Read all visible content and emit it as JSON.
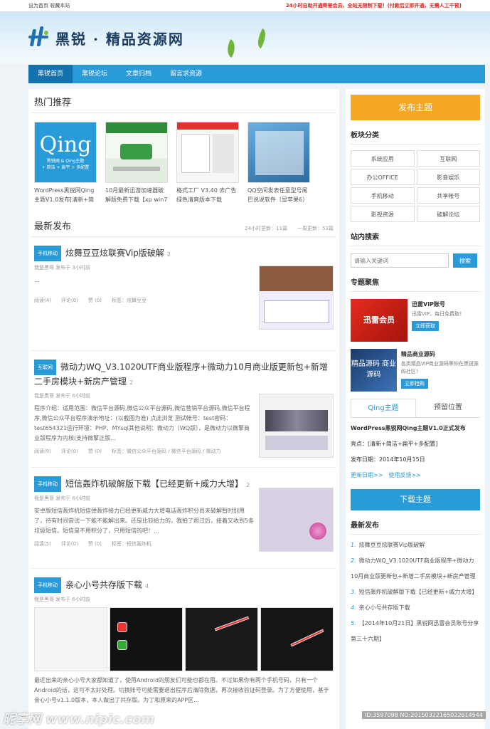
{
  "topbar": {
    "left": "设为首页 收藏本站",
    "notice": "24小时自助开通荣誉会员，全站无限制下载！(付款后立即开通，无需人工干预)"
  },
  "site": {
    "title": "黑锐 · 精品资源网"
  },
  "nav": [
    "黑锐首页",
    "黑锐论坛",
    "文章归档",
    "留言求资源"
  ],
  "hot": {
    "title": "热门推荐",
    "items": [
      {
        "caption": "WordPress黑锐网Qing主题V1.0发布[清新+简"
      },
      {
        "caption": "10月最新迅游加速器破解版免费下载【xp win7"
      },
      {
        "caption": "格式工厂 V3.40 去广告绿色清爽版本下载"
      },
      {
        "caption": "QQ空间发表任意型号尾巴说说软件（显苹果6）"
      }
    ]
  },
  "qing_thumb": {
    "big": "Qing",
    "sub1": "黑锐网 & Qing主题",
    "sub2": "+ 简洁 + 扁平 + 多配置"
  },
  "latest": {
    "title": "最新发布",
    "stats": "24小时更新：11篇　　一周更新：53篇"
  },
  "posts": [
    {
      "tag": "手机移动",
      "title": "炫舞豆豆炫联赛Vip版破解",
      "count": "2",
      "meta": "我是黑哥 发布于 3小时前",
      "excerpt": "...",
      "reads": "阅读(4)",
      "comments": "评论(0)",
      "likes": "赞 (0)",
      "tags": "标签：炫舞豆豆"
    },
    {
      "tag": "互联网",
      "title": "微动力WQ_V3.1020UTF商业版程序+微动力10月商业版更新包+新增二手房模块+新房产管理",
      "count": "2",
      "meta": "我是黑哥 发布于 6小时前",
      "excerpt": "程序介绍：适用范围：微信平台源码,微信公众平台源码,微信营销平台源码,微信平台程序,微信公众平台程序演示地址：(以截图为准) 点此浏览 测试帐号：test密码：test654321运行环境：PHP、MYsql其他说明：微动力（WQ版），是微动力以微擎商业版程序为内核(支持微擎正版...",
      "reads": "阅读(9)",
      "comments": "评论(0)",
      "likes": "赞 (0)",
      "tags": "标签：微信公众平台源码 / 微信平台源码 / 微动力"
    },
    {
      "tag": "手机移动",
      "title": "短信轰炸机破解版下载【已经更新+威力大增】",
      "count": "2",
      "meta": "我是黑哥 发布于 6小时前",
      "excerpt": "安卓版短信轰炸机短信弹轰炸接力已经更新威力大增电话轰炸积分尚未破解暂时别用了，待有时间尝试一下能不能解出来。还是比较给力的，我拍了照过后，接着又收到5条垃圾短信。短信是不用积分了，只用短信的吧！...",
      "reads": "阅读(5)",
      "comments": "评论(0)",
      "likes": "赞 (0)",
      "tags": "标签：短信轰炸机"
    },
    {
      "tag": "手机移动",
      "title": "亲心小号共存版下载",
      "count": "4",
      "meta": "我是黑哥 发布于 6小时前",
      "excerpt": "最近出来的亲心小号大家都知道了，使用Android的朋友们可能也都在用。不过如果你有两个手机号码，只有一个Android的话，这可不太好处理。切换账号可能需要退出程序后清除数据，再次接收验证码登录。为了方便使用，基于亲心小号v1.1.0版本，本人做出了共存版。为了和原来的APP区..."
    }
  ],
  "side": {
    "publish": "发布主题",
    "cats_title": "板块分类",
    "cats": [
      "系统应用",
      "互联网",
      "办公OFFICE",
      "影音娱乐",
      "手机移动",
      "共享帐号",
      "影视资源",
      "破解论坛"
    ],
    "search_title": "站内搜索",
    "search_placeholder": "请输入关键词",
    "search_btn": "搜索",
    "feat_title": "专题聚焦",
    "feats": [
      {
        "img": "迅雷会员",
        "name": "迅雷VIP账号",
        "desc": "迅雷VIP，每日免费取！",
        "btn": "立即获取"
      },
      {
        "img": "精品源码 商业源码",
        "name": "精品商业源码",
        "desc": "各类精品VIP商业源码等你在黑锐源码社区！",
        "btn": "立即抢购"
      }
    ],
    "tabs": [
      "Qing主题",
      "预留位置"
    ],
    "tab": {
      "title": "WordPress黑锐网Qing主题V1.0正式发布",
      "l1": "亮点：[清新+简洁+扁平+多配置]",
      "l2": "发布日期：2014年10月15日",
      "more1": "更新日期>>",
      "more2": "使用反馈>>"
    },
    "download": "下载主题",
    "recent_title": "最新发布",
    "recent": [
      "炫舞豆豆炫联赛Vip版破解",
      "微动力WQ_V3.1020UTF商业版程序+微动力10月商业版更新包+新增二手房模块+新房产管理",
      "短信轰炸机破解版下载【已经更新+威力大增】",
      "亲心小号共存版下载",
      "【2014年10月21日】黑锐网迅雷会员账号分享第三十六期】"
    ]
  },
  "watermark": {
    "left": "昵享网 www.nipic.com",
    "right": "ID:3597098 NO:20150322165022614544"
  },
  "colors": {
    "accent": "#2a9bd9",
    "orange": "#f5a623"
  }
}
